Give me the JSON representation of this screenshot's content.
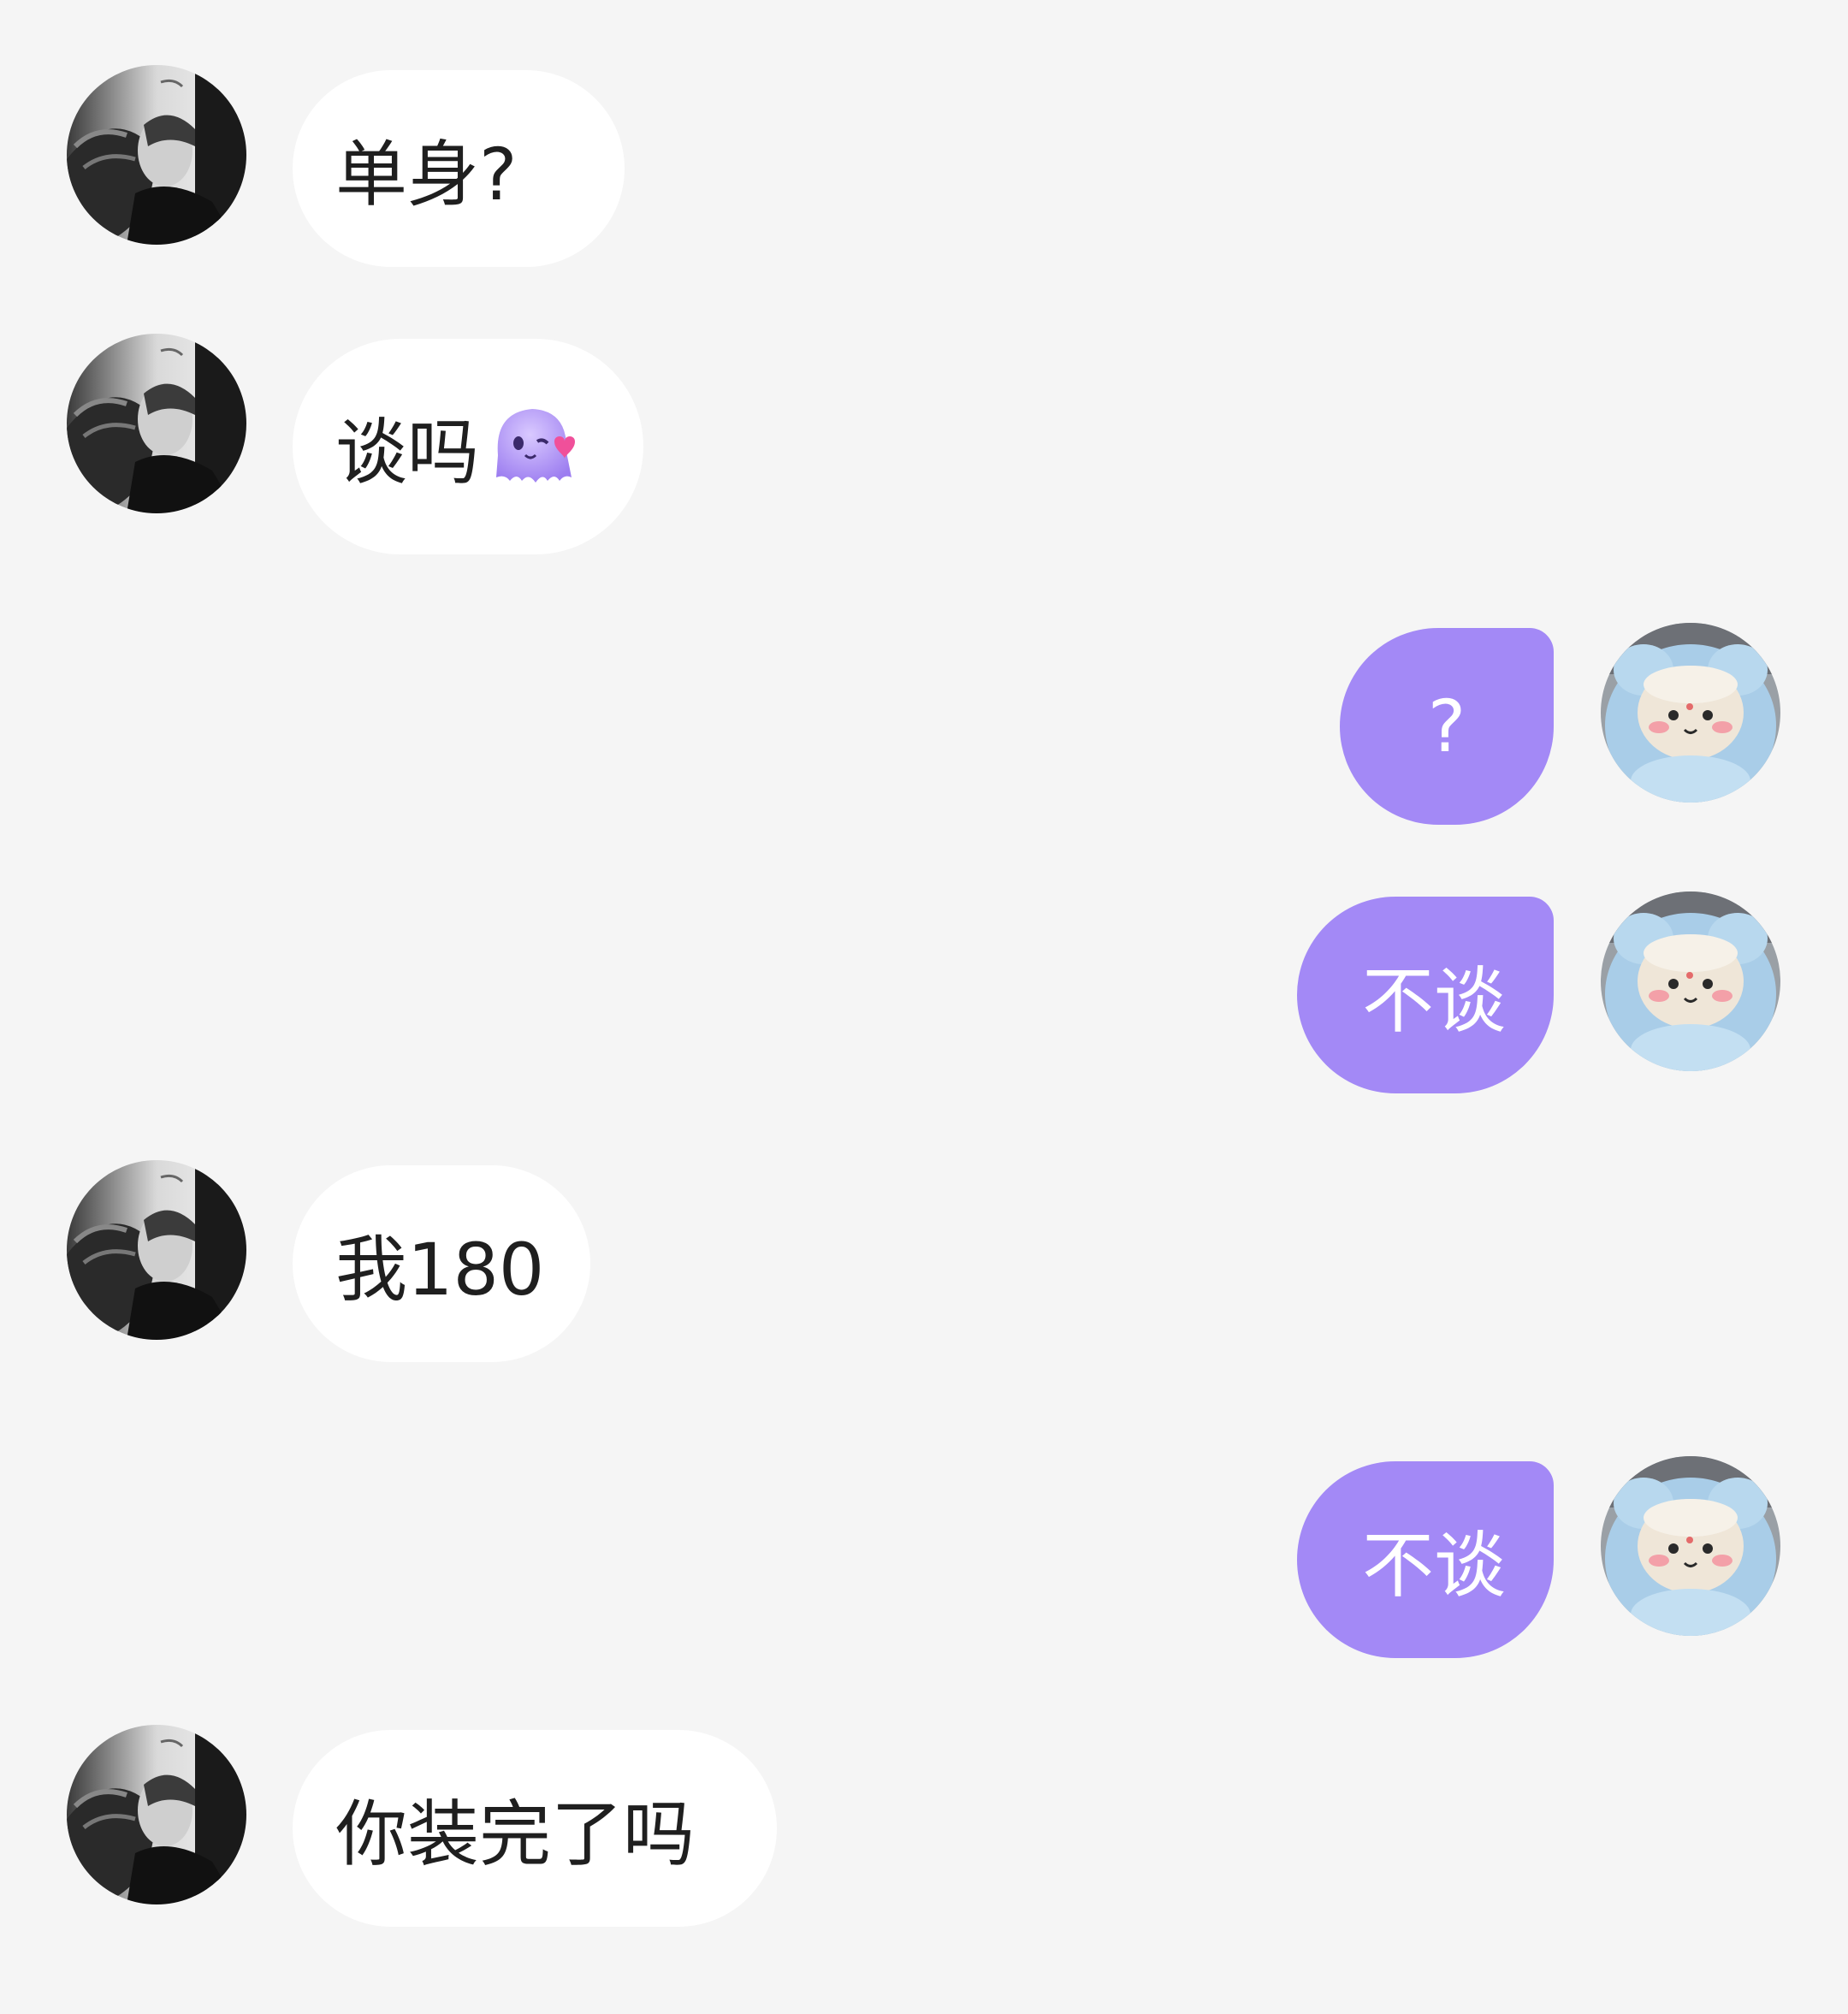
{
  "chat": {
    "messages": [
      {
        "side": "left",
        "text": "单身?"
      },
      {
        "side": "left",
        "text": "谈吗",
        "emoji": "octopus-heart-emoji"
      },
      {
        "side": "right",
        "text": "?"
      },
      {
        "side": "right",
        "text": "不谈"
      },
      {
        "side": "left",
        "text": "我180"
      },
      {
        "side": "right",
        "text": "不谈"
      },
      {
        "side": "left",
        "text": "你装完了吗"
      }
    ]
  },
  "colors": {
    "background": "#f5f5f5",
    "incoming_bubble": "#ffffff",
    "outgoing_bubble": "#a389f6",
    "incoming_text": "#1f1f1f",
    "outgoing_text": "#ffffff"
  },
  "avatars": {
    "incoming": "contact-avatar-photo",
    "outgoing": "plush-toy-avatar-photo"
  }
}
